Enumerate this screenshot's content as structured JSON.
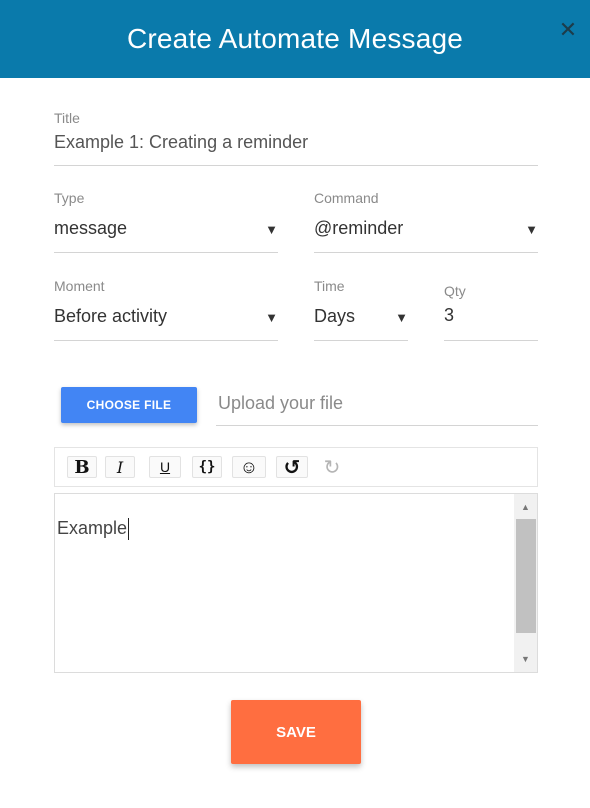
{
  "dialog": {
    "title": "Create Automate Message",
    "close_glyph": "✕"
  },
  "form": {
    "title": {
      "label": "Title",
      "value": "Example 1: Creating a reminder"
    },
    "type": {
      "label": "Type",
      "value": "message"
    },
    "command": {
      "label": "Command",
      "value": "@reminder"
    },
    "moment": {
      "label": "Moment",
      "value": "Before activity"
    },
    "time": {
      "label": "Time",
      "value": "Days"
    },
    "qty": {
      "label": "Qty",
      "value": "3"
    },
    "dropdown_glyph": "▼"
  },
  "upload": {
    "button_label": "CHOOSE FILE",
    "placeholder": "Upload your file"
  },
  "toolbar": {
    "bold": "B",
    "italic": "I",
    "underline": "U",
    "code": "{}",
    "emoji": "☺",
    "undo": "↺",
    "redo": "↻"
  },
  "editor": {
    "content": "Example",
    "scroll_up_glyph": "▲",
    "scroll_down_glyph": "▼"
  },
  "actions": {
    "save_label": "SAVE"
  },
  "colors": {
    "header": "#0a7aab",
    "choose_file": "#4285f4",
    "save": "#ff6e40"
  }
}
